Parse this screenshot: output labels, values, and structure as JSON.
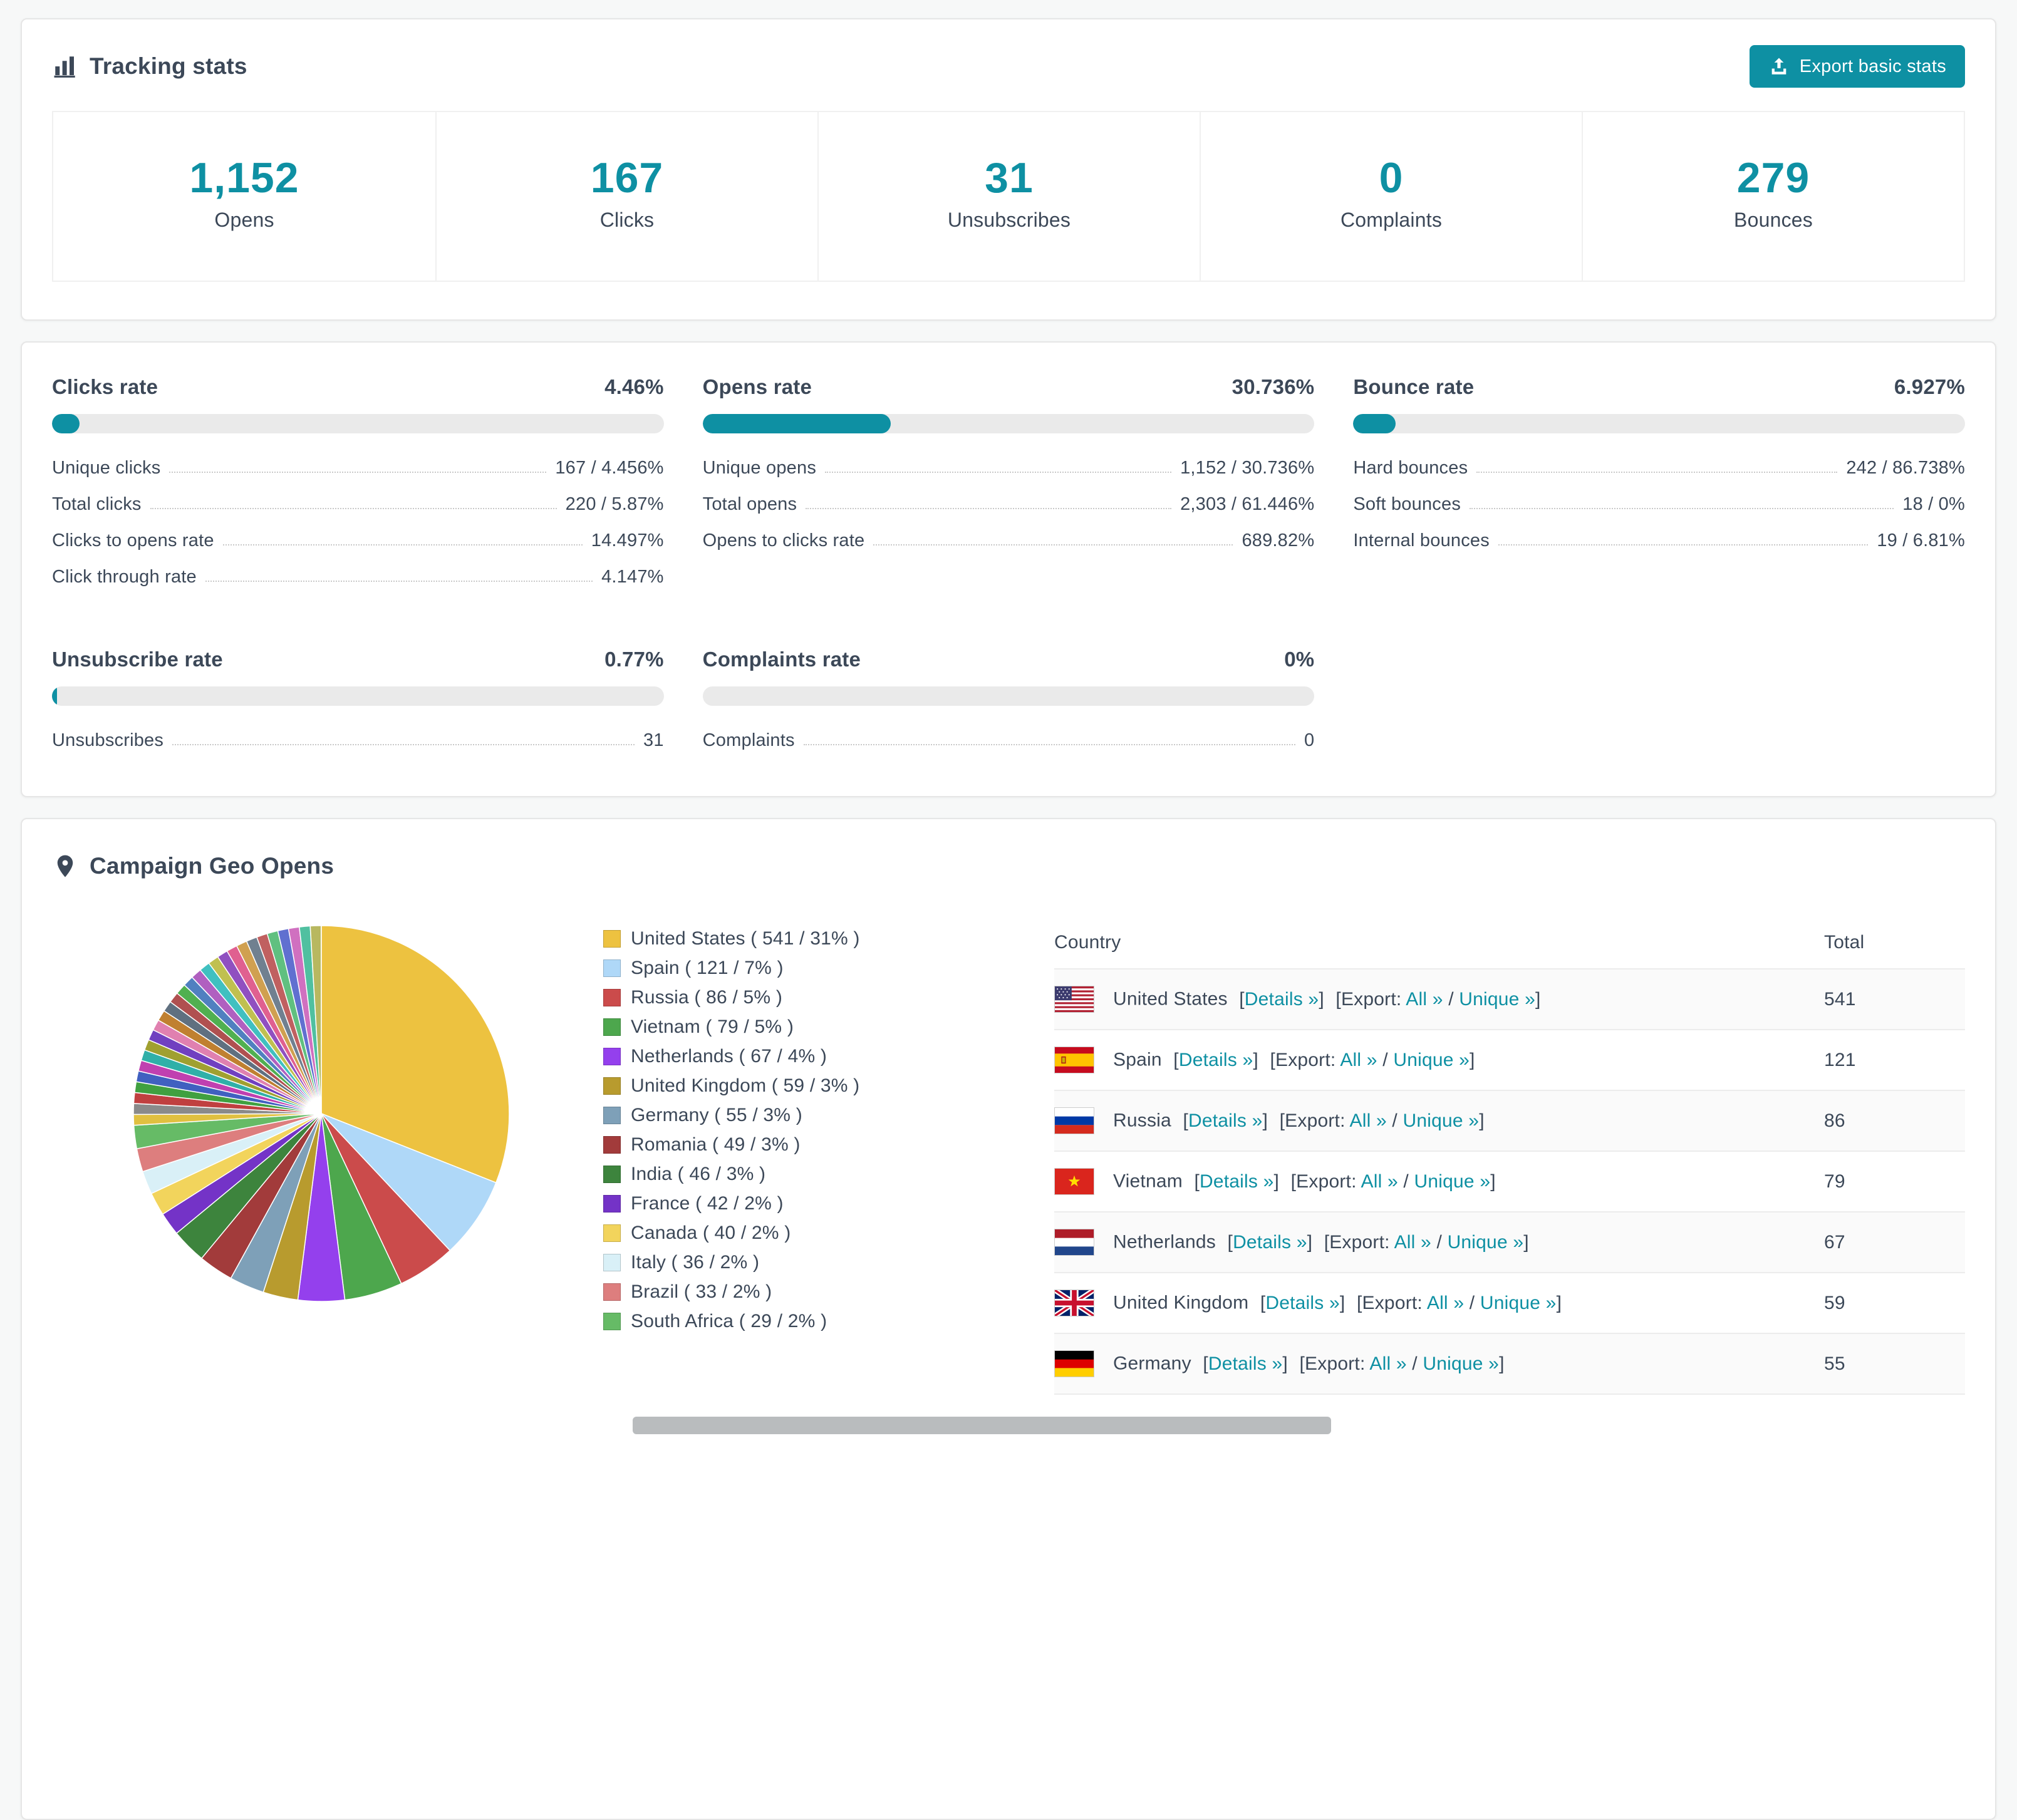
{
  "theme": {
    "accent": "#0e90a3",
    "text": "#3c4858",
    "card_border": "#e6e6e6",
    "progress_track": "#eaeaea"
  },
  "tracking": {
    "title": "Tracking stats",
    "export_button": "Export basic stats",
    "stats": [
      {
        "value": "1,152",
        "label": "Opens"
      },
      {
        "value": "167",
        "label": "Clicks"
      },
      {
        "value": "31",
        "label": "Unsubscribes"
      },
      {
        "value": "0",
        "label": "Complaints"
      },
      {
        "value": "279",
        "label": "Bounces"
      }
    ]
  },
  "rates": [
    {
      "title": "Clicks rate",
      "value": "4.46%",
      "percent": 4.46,
      "rows": [
        {
          "label": "Unique clicks",
          "value": "167 / 4.456%"
        },
        {
          "label": "Total clicks",
          "value": "220 / 5.87%"
        },
        {
          "label": "Clicks to opens rate",
          "value": "14.497%"
        },
        {
          "label": "Click through rate",
          "value": "4.147%"
        }
      ]
    },
    {
      "title": "Opens rate",
      "value": "30.736%",
      "percent": 30.736,
      "rows": [
        {
          "label": "Unique opens",
          "value": "1,152 / 30.736%"
        },
        {
          "label": "Total opens",
          "value": "2,303 / 61.446%"
        },
        {
          "label": "Opens to clicks rate",
          "value": "689.82%"
        }
      ]
    },
    {
      "title": "Bounce rate",
      "value": "6.927%",
      "percent": 6.927,
      "rows": [
        {
          "label": "Hard bounces",
          "value": "242 / 86.738%"
        },
        {
          "label": "Soft bounces",
          "value": "18 / 0%"
        },
        {
          "label": "Internal bounces",
          "value": "19 / 6.81%"
        }
      ]
    },
    {
      "title": "Unsubscribe rate",
      "value": "0.77%",
      "percent": 0.77,
      "rows": [
        {
          "label": "Unsubscribes",
          "value": "31"
        }
      ]
    },
    {
      "title": "Complaints rate",
      "value": "0%",
      "percent": 0,
      "rows": [
        {
          "label": "Complaints",
          "value": "0"
        }
      ]
    }
  ],
  "geo": {
    "title": "Campaign Geo Opens",
    "chart_data": {
      "type": "pie",
      "title": "Campaign Geo Opens",
      "unit": "opens",
      "slices": [
        {
          "label": "United States",
          "count": 541,
          "pct": 31,
          "color": "#edc240"
        },
        {
          "label": "Spain",
          "count": 121,
          "pct": 7,
          "color": "#afd8f8"
        },
        {
          "label": "Russia",
          "count": 86,
          "pct": 5,
          "color": "#cb4b4b"
        },
        {
          "label": "Vietnam",
          "count": 79,
          "pct": 5,
          "color": "#4da74d"
        },
        {
          "label": "Netherlands",
          "count": 67,
          "pct": 4,
          "color": "#9440ed"
        },
        {
          "label": "United Kingdom",
          "count": 59,
          "pct": 3,
          "color": "#b89b2e"
        },
        {
          "label": "Germany",
          "count": 55,
          "pct": 3,
          "color": "#7ea0b8"
        },
        {
          "label": "Romania",
          "count": 49,
          "pct": 3,
          "color": "#a23b3b"
        },
        {
          "label": "India",
          "count": 46,
          "pct": 3,
          "color": "#3d843d"
        },
        {
          "label": "France",
          "count": 42,
          "pct": 2,
          "color": "#7433c7"
        },
        {
          "label": "Canada",
          "count": 40,
          "pct": 2,
          "color": "#f2d45c"
        },
        {
          "label": "Italy",
          "count": 36,
          "pct": 2,
          "color": "#d9f0f7"
        },
        {
          "label": "Brazil",
          "count": 33,
          "pct": 2,
          "color": "#dd7e7e"
        },
        {
          "label": "South Africa",
          "count": 29,
          "pct": 2,
          "color": "#66bb66"
        }
      ],
      "other_slice_pct": 0.928,
      "other_slices_colors": [
        "#e0c040",
        "#8a8a8a",
        "#c04040",
        "#40a040",
        "#4060c0",
        "#c040b0",
        "#30b0a8",
        "#a0a030",
        "#7040c0",
        "#e080b0",
        "#c08030",
        "#607080",
        "#b05050",
        "#50b050",
        "#5080c0",
        "#b060c0",
        "#40c0c0",
        "#c0c050",
        "#9050c0",
        "#e06090",
        "#d0a050",
        "#708090",
        "#c06060",
        "#60c080",
        "#6070d0",
        "#d070c0",
        "#50c0a0",
        "#b8b860"
      ]
    },
    "table": {
      "headers": [
        "Country",
        "Total"
      ],
      "labels": {
        "open_bracket": "[",
        "close_bracket": "]",
        "details": "Details »",
        "export": "Export:",
        "all": "All »",
        "slash": "/",
        "unique": "Unique »"
      },
      "rows": [
        {
          "country": "United States",
          "flag": "us",
          "total": "541"
        },
        {
          "country": "Spain",
          "flag": "es",
          "total": "121"
        },
        {
          "country": "Russia",
          "flag": "ru",
          "total": "86"
        },
        {
          "country": "Vietnam",
          "flag": "vn",
          "total": "79"
        },
        {
          "country": "Netherlands",
          "flag": "nl",
          "total": "67"
        },
        {
          "country": "United Kingdom",
          "flag": "gb",
          "total": "59"
        },
        {
          "country": "Germany",
          "flag": "de",
          "total": "55"
        }
      ]
    }
  }
}
